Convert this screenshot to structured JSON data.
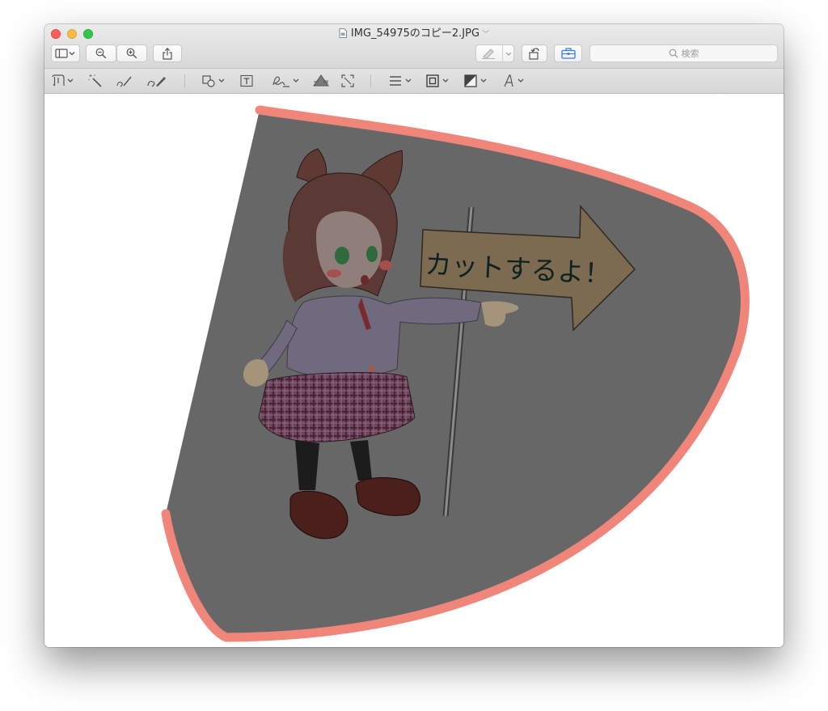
{
  "window": {
    "title": "IMG_54975のコピー2.JPG"
  },
  "toolbar": {
    "sidebar_icon": "sidebar-toggle-icon",
    "zoom_out_icon": "zoom-out-icon",
    "zoom_in_icon": "zoom-in-icon",
    "share_icon": "share-icon",
    "highlight_icon": "highlight-pen-icon",
    "rotate_icon": "rotate-icon",
    "markup_icon": "toolbox-icon",
    "accent_color": "#3478f6",
    "search_placeholder": "検索"
  },
  "markup_tools": [
    "selection-icon",
    "instant-alpha-icon",
    "sketch-icon",
    "draw-icon",
    "shapes-icon",
    "text-icon",
    "sign-icon",
    "adjust-color-icon",
    "adjust-size-icon",
    "shape-style-icon",
    "border-color-icon",
    "fill-color-icon",
    "text-style-icon"
  ],
  "image": {
    "sign_text": "カットするよ！",
    "selection_stroke_color": "#f0857a",
    "dim_overlay_color": "#676767"
  }
}
